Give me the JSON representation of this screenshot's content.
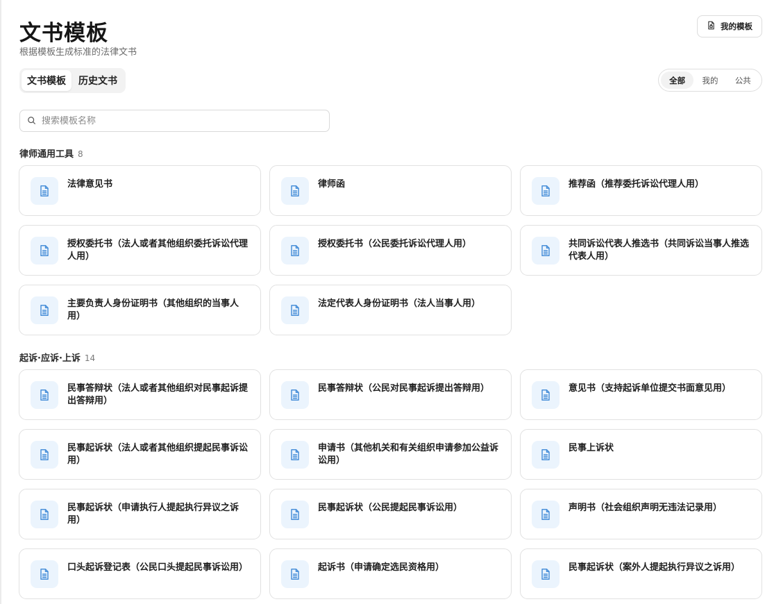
{
  "header": {
    "title": "文书模板",
    "subtitle": "根据模板生成标准的法律文书",
    "my_templates_label": "我的模板"
  },
  "tabs": [
    {
      "label": "文书模板",
      "active": true
    },
    {
      "label": "历史文书",
      "active": false
    }
  ],
  "filters": [
    {
      "label": "全部",
      "active": true
    },
    {
      "label": "我的",
      "active": false
    },
    {
      "label": "公共",
      "active": false
    }
  ],
  "search": {
    "placeholder": "搜索模板名称",
    "value": ""
  },
  "colors": {
    "accent": "#4a90d9",
    "icon_bg": "#ebf4fd"
  },
  "sections": [
    {
      "title": "律师通用工具",
      "count": "8",
      "items": [
        {
          "title": "法律意见书",
          "icon": "document-icon"
        },
        {
          "title": "律师函",
          "icon": "document-icon"
        },
        {
          "title": "推荐函（推荐委托诉讼代理人用）",
          "icon": "document-icon"
        },
        {
          "title": "授权委托书（法人或者其他组织委托诉讼代理人用）",
          "icon": "document-icon"
        },
        {
          "title": "授权委托书（公民委托诉讼代理人用）",
          "icon": "document-icon"
        },
        {
          "title": "共同诉讼代表人推选书（共同诉讼当事人推选代表人用）",
          "icon": "document-icon"
        },
        {
          "title": "主要负责人身份证明书（其他组织的当事人用）",
          "icon": "document-icon"
        },
        {
          "title": "法定代表人身份证明书（法人当事人用）",
          "icon": "document-icon"
        }
      ]
    },
    {
      "title": "起诉·应诉·上诉",
      "count": "14",
      "items": [
        {
          "title": "民事答辩状（法人或者其他组织对民事起诉提出答辩用）",
          "icon": "document-icon"
        },
        {
          "title": "民事答辩状（公民对民事起诉提出答辩用）",
          "icon": "document-icon"
        },
        {
          "title": "意见书（支持起诉单位提交书面意见用）",
          "icon": "document-icon"
        },
        {
          "title": "民事起诉状（法人或者其他组织提起民事诉讼用）",
          "icon": "document-icon"
        },
        {
          "title": "申请书（其他机关和有关组织申请参加公益诉讼用）",
          "icon": "document-icon"
        },
        {
          "title": "民事上诉状",
          "icon": "document-icon"
        },
        {
          "title": "民事起诉状（申请执行人提起执行异议之诉用）",
          "icon": "document-icon"
        },
        {
          "title": "民事起诉状（公民提起民事诉讼用）",
          "icon": "document-icon"
        },
        {
          "title": "声明书（社会组织声明无违法记录用）",
          "icon": "document-icon"
        },
        {
          "title": "口头起诉登记表（公民口头提起民事诉讼用）",
          "icon": "document-icon"
        },
        {
          "title": "起诉书（申请确定选民资格用）",
          "icon": "document-icon"
        },
        {
          "title": "民事起诉状（案外人提起执行异议之诉用）",
          "icon": "document-icon"
        }
      ]
    }
  ]
}
